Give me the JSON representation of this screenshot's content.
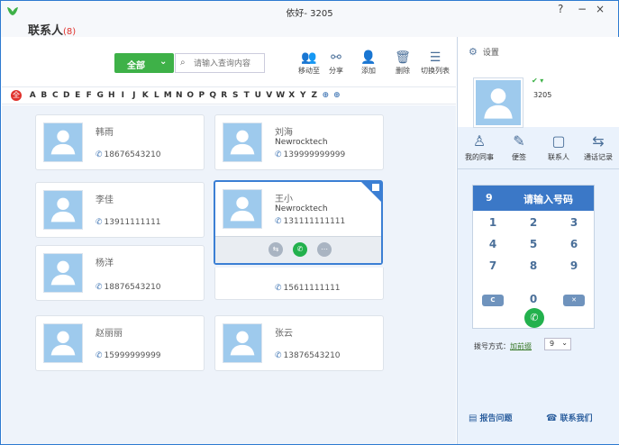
{
  "window": {
    "title": "依好- 3205",
    "help": "?",
    "minimize": "−",
    "close": "×"
  },
  "header": {
    "title": "联系人",
    "count": "(8)",
    "filter_label": "全部",
    "filter_chevron": "⌄",
    "search_placeholder": "请输入查询内容"
  },
  "toolbar": [
    {
      "label": "移动至",
      "icon": "move-icon",
      "glyph": "👥"
    },
    {
      "label": "分享",
      "icon": "share-icon",
      "glyph": "⚯"
    },
    {
      "label": "添加",
      "icon": "add-contact-icon",
      "glyph": "👤"
    },
    {
      "label": "删除",
      "icon": "trash-icon",
      "glyph": "🗑"
    },
    {
      "label": "切换列表",
      "icon": "list-icon",
      "glyph": "☰"
    }
  ],
  "letterbar": {
    "all": "全",
    "letters": [
      "A",
      "B",
      "C",
      "D",
      "E",
      "F",
      "G",
      "H",
      "I",
      "J",
      "K",
      "L",
      "M",
      "N",
      "O",
      "P",
      "Q",
      "R",
      "S",
      "T",
      "U",
      "V",
      "W",
      "X",
      "Y",
      "Z",
      "⊕",
      "⊕"
    ]
  },
  "contacts": [
    {
      "name": "韩雨",
      "org": "",
      "phone": "18676543210"
    },
    {
      "name": "刘海",
      "org": "Newrocktech",
      "phone": "139999999999"
    },
    {
      "name": "李佳",
      "org": "",
      "phone": "13911111111"
    },
    {
      "name": "王小",
      "org": "Newrocktech",
      "phone": "131111111111"
    },
    {
      "name": "杨洋",
      "org": "",
      "phone": "18876543210"
    },
    {
      "name": "",
      "org": "",
      "phone": "15611111111"
    },
    {
      "name": "赵丽丽",
      "org": "",
      "phone": "15999999999"
    },
    {
      "name": "张云",
      "org": "",
      "phone": "13876543210"
    }
  ],
  "selected_actions": {
    "transfer": "⇆",
    "call": "✆",
    "more": "⋯"
  },
  "user": {
    "settings": "设置",
    "status": "✔ ▾",
    "ext": "3205"
  },
  "nav": [
    {
      "label": "我的同事",
      "icon": "colleague-icon",
      "glyph": "♙"
    },
    {
      "label": "便签",
      "icon": "note-icon",
      "glyph": "✎"
    },
    {
      "label": "联系人",
      "icon": "contacts-icon",
      "glyph": "▢"
    },
    {
      "label": "通话记录",
      "icon": "call-log-icon",
      "glyph": "⇆"
    }
  ],
  "dialpad": {
    "value": "9",
    "hint": "请输入号码",
    "keys": [
      "1",
      "2",
      "3",
      "4",
      "5",
      "6",
      "7",
      "8",
      "9",
      "0"
    ],
    "clear": "C",
    "backspace": "✕",
    "call": "✆"
  },
  "dial_mode": {
    "label": "拨号方式：",
    "link": "加前缀",
    "value": "9",
    "chevron": "⌄"
  },
  "footer": {
    "report": "报告问题",
    "contact_us": "联系我们"
  },
  "colors": {
    "accent": "#3b78c7",
    "green": "#3eb148",
    "count": "#e0322c",
    "avatar": "#9ecaed"
  }
}
